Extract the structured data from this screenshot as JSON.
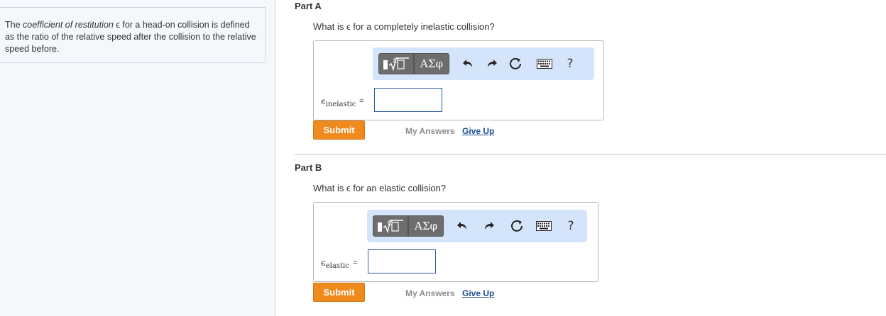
{
  "intro": {
    "text_before": "The ",
    "term": "coefficient of restitution",
    "text_after": " ϵ for a head-on collision is defined as the ratio of the relative speed after the collision to the relative speed before."
  },
  "toolbar": {
    "template_icon": "square-root-template-icon",
    "greek_label": "ΑΣφ",
    "undo_icon": "undo-icon",
    "redo_icon": "redo-icon",
    "reset_icon": "reset-icon",
    "keyboard_icon": "keyboard-icon",
    "help_label": "?"
  },
  "parts": [
    {
      "title": "Part A",
      "question": "What is ϵ for a completely inelastic collision?",
      "var_symbol": "ϵ",
      "var_subscript": "inelastic",
      "equals": "=",
      "input_value": "",
      "submit_label": "Submit",
      "my_answers_label": "My Answers",
      "give_up_label": "Give Up"
    },
    {
      "title": "Part B",
      "question": "What is ϵ for an elastic collision?",
      "var_symbol": "ϵ",
      "var_subscript": "elastic",
      "equals": "=",
      "input_value": "",
      "submit_label": "Submit",
      "my_answers_label": "My Answers",
      "give_up_label": "Give Up"
    }
  ],
  "colors": {
    "submit": "#ef8a1f",
    "toolbar_bg": "#d4e5fb",
    "link": "#1a4c8e",
    "left_pane_bg": "#f4f8fd"
  }
}
